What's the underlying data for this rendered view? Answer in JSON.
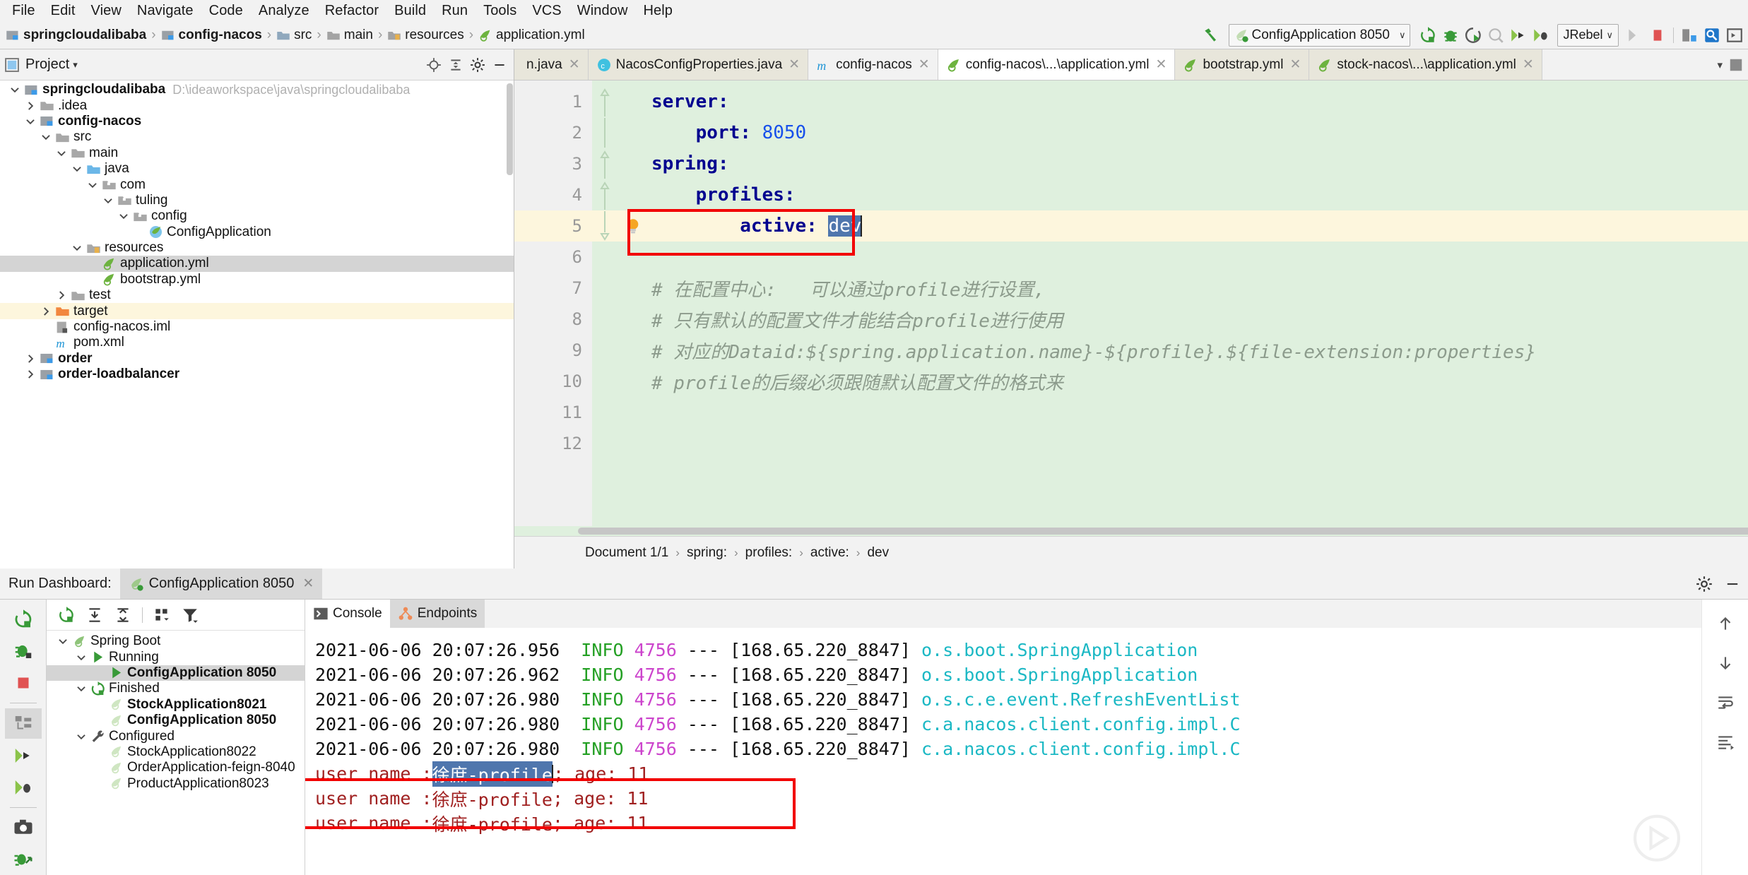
{
  "menu": {
    "items": [
      "File",
      "Edit",
      "View",
      "Navigate",
      "Code",
      "Analyze",
      "Refactor",
      "Build",
      "Run",
      "Tools",
      "VCS",
      "Window",
      "Help"
    ]
  },
  "breadcrumb_top": {
    "items": [
      {
        "label": "springcloudalibaba",
        "icon": "module-icon"
      },
      {
        "label": "config-nacos",
        "icon": "module-icon"
      },
      {
        "label": "src",
        "icon": "folder-src-icon"
      },
      {
        "label": "main",
        "icon": "folder-icon"
      },
      {
        "label": "resources",
        "icon": "folder-resources-icon"
      },
      {
        "label": "application.yml",
        "icon": "yml-icon"
      }
    ],
    "separator": "›"
  },
  "toolbar": {
    "build_icon": "hammer-icon",
    "run_config": "ConfigApplication 8050",
    "run_config_caret": "∨",
    "jrebel_label": "JRebel",
    "jrebel_caret": "∨",
    "buttons": [
      "rerun-icon",
      "debug-icon",
      "run-with-coverage-icon",
      "profile-icon",
      "jrebel-run-icon",
      "jrebel-debug-icon"
    ],
    "right_buttons": [
      "stop-disabled-icon",
      "stop-icon",
      "project-structure-icon",
      "search-everywhere-icon",
      "open-icon"
    ]
  },
  "project_panel": {
    "title": "Project",
    "title_caret": "▾",
    "header_icons": [
      "locate-icon",
      "collapse-all-icon",
      "settings-gear-icon",
      "hide-icon"
    ],
    "tree": [
      {
        "depth": 0,
        "twisty": "down",
        "icon": "module-icon",
        "label": "springcloudalibaba",
        "bold": true,
        "path": "D:\\ideaworkspace\\java\\springcloudalibaba",
        "state": "normal"
      },
      {
        "depth": 1,
        "twisty": "right",
        "icon": "folder-icon",
        "label": ".idea",
        "bold": false,
        "path": "",
        "state": "normal"
      },
      {
        "depth": 1,
        "twisty": "down",
        "icon": "module-icon",
        "label": "config-nacos",
        "bold": true,
        "path": "",
        "state": "normal"
      },
      {
        "depth": 2,
        "twisty": "down",
        "icon": "folder-icon",
        "label": "src",
        "bold": false,
        "path": "",
        "state": "normal"
      },
      {
        "depth": 3,
        "twisty": "down",
        "icon": "folder-icon",
        "label": "main",
        "bold": false,
        "path": "",
        "state": "normal"
      },
      {
        "depth": 4,
        "twisty": "down",
        "icon": "folder-src-icon",
        "label": "java",
        "bold": false,
        "path": "",
        "state": "normal"
      },
      {
        "depth": 5,
        "twisty": "down",
        "icon": "package-icon",
        "label": "com",
        "bold": false,
        "path": "",
        "state": "normal"
      },
      {
        "depth": 6,
        "twisty": "down",
        "icon": "package-icon",
        "label": "tuling",
        "bold": false,
        "path": "",
        "state": "normal"
      },
      {
        "depth": 7,
        "twisty": "down",
        "icon": "package-icon",
        "label": "config",
        "bold": false,
        "path": "",
        "state": "normal"
      },
      {
        "depth": 8,
        "twisty": "none",
        "icon": "spring-class-icon",
        "label": "ConfigApplication",
        "bold": false,
        "path": "",
        "state": "normal"
      },
      {
        "depth": 4,
        "twisty": "down",
        "icon": "folder-resources-icon",
        "label": "resources",
        "bold": false,
        "path": "",
        "state": "normal"
      },
      {
        "depth": 5,
        "twisty": "none",
        "icon": "yml-icon",
        "label": "application.yml",
        "bold": false,
        "path": "",
        "state": "selected"
      },
      {
        "depth": 5,
        "twisty": "none",
        "icon": "yml-icon",
        "label": "bootstrap.yml",
        "bold": false,
        "path": "",
        "state": "normal"
      },
      {
        "depth": 3,
        "twisty": "right",
        "icon": "folder-icon",
        "label": "test",
        "bold": false,
        "path": "",
        "state": "normal"
      },
      {
        "depth": 2,
        "twisty": "right",
        "icon": "folder-target-icon",
        "label": "target",
        "bold": false,
        "path": "",
        "state": "highlight"
      },
      {
        "depth": 2,
        "twisty": "none",
        "icon": "iml-icon",
        "label": "config-nacos.iml",
        "bold": false,
        "path": "",
        "state": "normal"
      },
      {
        "depth": 2,
        "twisty": "none",
        "icon": "maven-icon",
        "label": "pom.xml",
        "bold": false,
        "path": "",
        "state": "normal"
      },
      {
        "depth": 1,
        "twisty": "right",
        "icon": "module-icon",
        "label": "order",
        "bold": true,
        "path": "",
        "state": "normal"
      },
      {
        "depth": 1,
        "twisty": "right",
        "icon": "module-icon",
        "label": "order-loadbalancer",
        "bold": true,
        "path": "",
        "state": "normal"
      }
    ]
  },
  "editor": {
    "tabs": [
      {
        "label": "n.java",
        "icon": "java-class-icon",
        "active": false,
        "truncated": true
      },
      {
        "label": "NacosConfigProperties.java",
        "icon": "java-class-icon",
        "active": false,
        "truncated": false
      },
      {
        "label": "config-nacos",
        "icon": "maven-icon",
        "active": false,
        "truncated": false
      },
      {
        "label": "config-nacos\\...\\application.yml",
        "icon": "yml-icon",
        "active": true,
        "truncated": false
      },
      {
        "label": "bootstrap.yml",
        "icon": "yml-icon",
        "active": false,
        "truncated": false
      },
      {
        "label": "stock-nacos\\...\\application.yml",
        "icon": "yml-icon",
        "active": false,
        "truncated": false
      }
    ],
    "tab_close": "✕",
    "line_numbers": [
      "1",
      "2",
      "3",
      "4",
      "5",
      "6",
      "7",
      "8",
      "9",
      "10",
      "11",
      "12"
    ],
    "lines": [
      {
        "n": 1,
        "indent": 0,
        "tokens": [
          {
            "t": "server:",
            "c": "k"
          }
        ],
        "fold": "start",
        "current": false,
        "bulb": false
      },
      {
        "n": 2,
        "indent": 1,
        "tokens": [
          {
            "t": "port:",
            "c": "k"
          },
          {
            "t": " ",
            "c": "p"
          },
          {
            "t": "8050",
            "c": "num"
          }
        ],
        "fold": "mid",
        "current": false,
        "bulb": false
      },
      {
        "n": 3,
        "indent": 0,
        "tokens": [
          {
            "t": "spring:",
            "c": "k"
          }
        ],
        "fold": "start",
        "current": false,
        "bulb": false
      },
      {
        "n": 4,
        "indent": 1,
        "tokens": [
          {
            "t": "profiles:",
            "c": "k"
          }
        ],
        "fold": "start",
        "current": false,
        "bulb": false
      },
      {
        "n": 5,
        "indent": 2,
        "tokens": [
          {
            "t": "active:",
            "c": "k"
          },
          {
            "t": " ",
            "c": "p"
          },
          {
            "t": "dev",
            "c": "sel"
          }
        ],
        "fold": "end",
        "current": true,
        "bulb": true
      },
      {
        "n": 6,
        "indent": 0,
        "tokens": [],
        "fold": "none",
        "current": false,
        "bulb": false
      },
      {
        "n": 7,
        "indent": 0,
        "tokens": [
          {
            "t": "# 在配置中心:   可以通过profile进行设置,",
            "c": "cm"
          }
        ],
        "fold": "none",
        "current": false,
        "bulb": false
      },
      {
        "n": 8,
        "indent": 0,
        "tokens": [
          {
            "t": "# 只有默认的配置文件才能结合profile进行使用",
            "c": "cm"
          }
        ],
        "fold": "none",
        "current": false,
        "bulb": false
      },
      {
        "n": 9,
        "indent": 0,
        "tokens": [
          {
            "t": "# 对应的Dataid:${spring.application.name}-${profile}.${file-extension:properties}",
            "c": "cm"
          }
        ],
        "fold": "none",
        "current": false,
        "bulb": false
      },
      {
        "n": 10,
        "indent": 0,
        "tokens": [
          {
            "t": "# profile的后缀必须跟随默认配置文件的格式来",
            "c": "cm"
          }
        ],
        "fold": "none",
        "current": false,
        "bulb": false
      },
      {
        "n": 11,
        "indent": 0,
        "tokens": [],
        "fold": "none",
        "current": false,
        "bulb": false
      },
      {
        "n": 12,
        "indent": 0,
        "tokens": [],
        "fold": "none",
        "current": false,
        "bulb": false
      }
    ],
    "breadcrumb": [
      "Document 1/1",
      "spring:",
      "profiles:",
      "active:",
      "dev"
    ],
    "breadcrumb_sep": "›",
    "annotation_color": "#f20000",
    "selection_color": "#4f76ad",
    "background_color": "#dff0de",
    "current_line_color": "#fdf6dd"
  },
  "run_dashboard": {
    "title": "Run Dashboard:",
    "tab_label": "ConfigApplication 8050",
    "tab_icon": "spring-running-icon",
    "tab_close": "✕",
    "header_right_icons": [
      "settings-gear-icon",
      "hide-icon"
    ],
    "rail_icons": [
      "rerun-icon",
      "debug-icon",
      "stop-icon",
      "layout-icon",
      "jrebel-run-icon",
      "jrebel-debug-icon",
      "camera-icon",
      "debug-attach-icon"
    ],
    "toolbar_icons": [
      "rerun-icon",
      "expand-all-icon",
      "collapse-all-icon",
      "group-by-icon",
      "filter-icon"
    ],
    "tree": [
      {
        "depth": 0,
        "twisty": "down",
        "icon": "spring-icon",
        "label": "Spring Boot",
        "bold": false,
        "state": "normal"
      },
      {
        "depth": 1,
        "twisty": "down",
        "icon": "run-green-icon",
        "label": "Running",
        "bold": false,
        "state": "normal"
      },
      {
        "depth": 2,
        "twisty": "none",
        "icon": "run-green-icon",
        "label": "ConfigApplication 8050",
        "bold": true,
        "state": "selected"
      },
      {
        "depth": 1,
        "twisty": "down",
        "icon": "rerun-icon",
        "label": "Finished",
        "bold": false,
        "state": "normal"
      },
      {
        "depth": 2,
        "twisty": "none",
        "icon": "spring-faded-icon",
        "label": "StockApplication8021",
        "bold": true,
        "state": "normal"
      },
      {
        "depth": 2,
        "twisty": "none",
        "icon": "spring-faded-icon",
        "label": "ConfigApplication 8050",
        "bold": true,
        "state": "normal"
      },
      {
        "depth": 1,
        "twisty": "down",
        "icon": "wrench-icon",
        "label": "Configured",
        "bold": false,
        "state": "normal"
      },
      {
        "depth": 2,
        "twisty": "none",
        "icon": "spring-faded-icon",
        "label": "StockApplication8022",
        "bold": false,
        "state": "normal"
      },
      {
        "depth": 2,
        "twisty": "none",
        "icon": "spring-faded-icon",
        "label": "OrderApplication-feign-8040",
        "bold": false,
        "state": "normal"
      },
      {
        "depth": 2,
        "twisty": "none",
        "icon": "spring-faded-icon",
        "label": "ProductApplication8023",
        "bold": false,
        "state": "normal"
      }
    ]
  },
  "console": {
    "tabs": [
      {
        "label": "Console",
        "icon": "console-icon",
        "active": true
      },
      {
        "label": "Endpoints",
        "icon": "endpoints-icon",
        "active": false
      }
    ],
    "log_lines": [
      {
        "type": "log",
        "timestamp": "2021-06-06 20:07:26.956",
        "level": "INFO",
        "pid": "4756",
        "dashes": "---",
        "thread": "[168.65.220_8847]",
        "logger": "o.s.boot.SpringApplication"
      },
      {
        "type": "log",
        "timestamp": "2021-06-06 20:07:26.962",
        "level": "INFO",
        "pid": "4756",
        "dashes": "---",
        "thread": "[168.65.220_8847]",
        "logger": "o.s.boot.SpringApplication"
      },
      {
        "type": "log",
        "timestamp": "2021-06-06 20:07:26.980",
        "level": "INFO",
        "pid": "4756",
        "dashes": "---",
        "thread": "[168.65.220_8847]",
        "logger": "o.s.c.e.event.RefreshEventList"
      },
      {
        "type": "log",
        "timestamp": "2021-06-06 20:07:26.980",
        "level": "INFO",
        "pid": "4756",
        "dashes": "---",
        "thread": "[168.65.220_8847]",
        "logger": "c.a.nacos.client.config.impl.C"
      },
      {
        "type": "log",
        "timestamp": "2021-06-06 20:07:26.980",
        "level": "INFO",
        "pid": "4756",
        "dashes": "---",
        "thread": "[168.65.220_8847]",
        "logger": "c.a.nacos.client.config.impl.C"
      }
    ],
    "user_lines": [
      {
        "prefix": "user name :",
        "selected": "徐庶-profile",
        "suffix": "; age: 11",
        "has_selection": true,
        "in_box": true
      },
      {
        "prefix": "user name :",
        "selected": "徐庶-profile",
        "suffix": "; age: 11",
        "has_selection": false,
        "in_box": true
      },
      {
        "prefix": "user name :",
        "selected": "徐庶-profile",
        "suffix": "; age: 11",
        "has_selection": false,
        "in_box": false
      }
    ],
    "right_rail_icons": [
      "scroll-up-icon",
      "scroll-down-icon",
      "soft-wrap-icon",
      "scroll-end-icon"
    ],
    "annotation_color": "#f20000",
    "user_text_color": "#a02020"
  }
}
